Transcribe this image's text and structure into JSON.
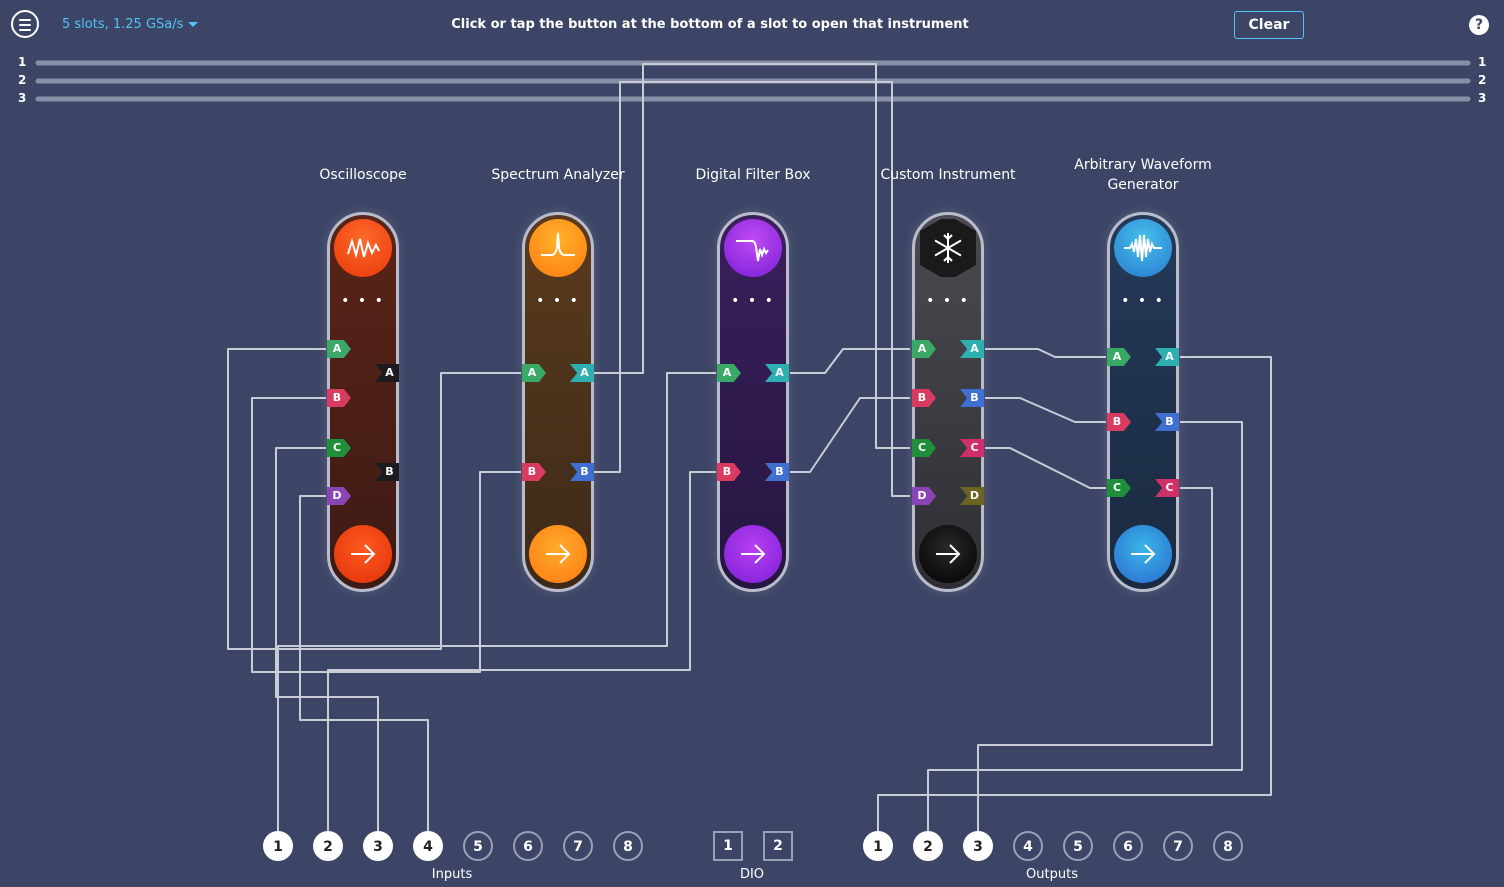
{
  "header": {
    "slot_config": "5 slots, 1.25 GSa/s",
    "hint": "Click or tap the button at the bottom of a slot to open that instrument",
    "clear_label": "Clear",
    "help_label": "?"
  },
  "buses": [
    "1",
    "2",
    "3"
  ],
  "slots": [
    {
      "title": "Oscilloscope",
      "icon": "oscilloscope-icon",
      "dots": "• • •",
      "color_top": "#ff5a1f",
      "color_bottom": "#e83a0c",
      "body": "#4a1f17",
      "inputs": [
        "A",
        "B",
        "C",
        "D"
      ],
      "outputs": [
        "A",
        "B"
      ]
    },
    {
      "title": "Spectrum Analyzer",
      "icon": "spectrum-icon",
      "dots": "• • •",
      "color_top": "#ffab2a",
      "color_bottom": "#ff7a12",
      "body": "#4b3420",
      "inputs": [
        "A",
        "B"
      ],
      "outputs": [
        "A",
        "B"
      ]
    },
    {
      "title": "Digital Filter Box",
      "icon": "filter-icon",
      "dots": "• • •",
      "color_top": "#b83ff0",
      "color_bottom": "#7a1fd8",
      "body": "#311a4a",
      "inputs": [
        "A",
        "B"
      ],
      "outputs": [
        "A",
        "B"
      ]
    },
    {
      "title": "Custom Instrument",
      "icon": "snowflake-icon",
      "dots": "• • •",
      "color_top": "#2a2a2a",
      "color_bottom": "#000000",
      "body": "#3a3a3e",
      "inputs": [
        "A",
        "B",
        "C",
        "D"
      ],
      "outputs": [
        "A",
        "B",
        "C",
        "D"
      ]
    },
    {
      "title": "Arbitrary Waveform Generator",
      "icon": "waveform-icon",
      "dots": "• • •",
      "color_top": "#3ab6e6",
      "color_bottom": "#2a7ad0",
      "body": "#1f3450",
      "inputs": [
        "A",
        "B",
        "C"
      ],
      "outputs": [
        "A",
        "B",
        "C"
      ]
    }
  ],
  "inputs": {
    "label": "Inputs",
    "items": [
      {
        "label": "1",
        "connected": true
      },
      {
        "label": "2",
        "connected": true
      },
      {
        "label": "3",
        "connected": true
      },
      {
        "label": "4",
        "connected": true
      },
      {
        "label": "5",
        "connected": false
      },
      {
        "label": "6",
        "connected": false
      },
      {
        "label": "7",
        "connected": false
      },
      {
        "label": "8",
        "connected": false
      }
    ]
  },
  "dio": {
    "label": "DIO",
    "items": [
      "1",
      "2"
    ]
  },
  "outputs": {
    "label": "Outputs",
    "items": [
      {
        "label": "1",
        "connected": true
      },
      {
        "label": "2",
        "connected": true
      },
      {
        "label": "3",
        "connected": true
      },
      {
        "label": "4",
        "connected": false
      },
      {
        "label": "5",
        "connected": false
      },
      {
        "label": "6",
        "connected": false
      },
      {
        "label": "7",
        "connected": false
      },
      {
        "label": "8",
        "connected": false
      }
    ]
  },
  "colors": {
    "background": "#3d4566",
    "accent": "#4fc3f7",
    "wire": "#c9ccd6"
  }
}
